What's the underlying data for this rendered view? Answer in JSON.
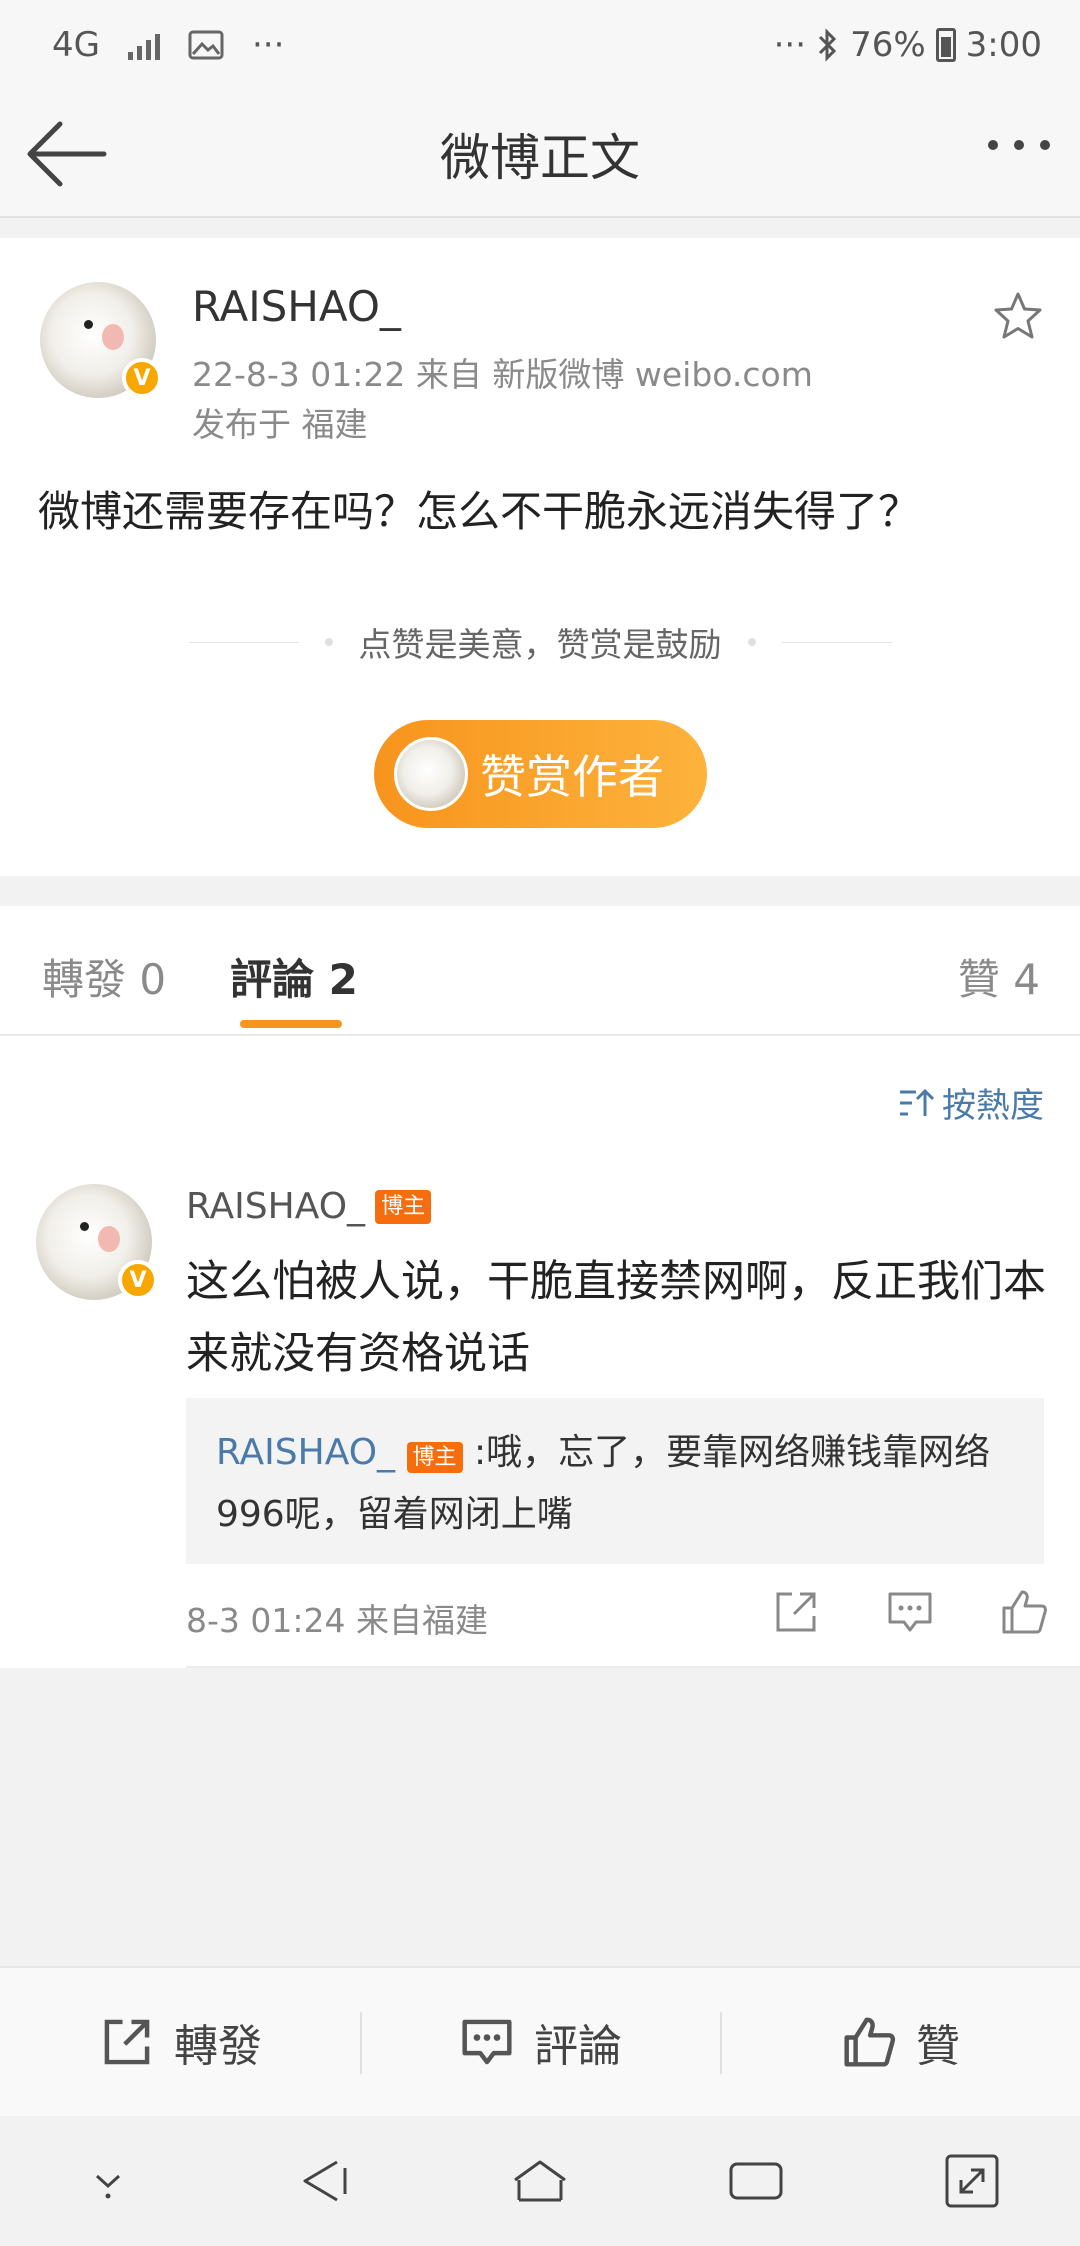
{
  "status_bar": {
    "network": "4G",
    "more": "···",
    "more_right": "···",
    "battery_percent": "76%",
    "time": "3:00"
  },
  "navbar": {
    "title": "微博正文"
  },
  "post": {
    "author": "RAISHAO_",
    "verified_badge": "V",
    "meta": "22-8-3 01:22   来自 新版微博 weibo.com",
    "location": "发布于 福建",
    "text": "微博还需要存在吗？怎么不干脆永远消失得了？",
    "reward_hint": "点赞是美意，赞赏是鼓励",
    "reward_button": "赞赏作者"
  },
  "tabs": {
    "repost": "轉發 0",
    "comment": "評論 2",
    "like": "贊 4"
  },
  "comments": {
    "sort_label": "按熱度",
    "items": [
      {
        "author": "RAISHAO_",
        "badge": "博主",
        "verified_badge": "V",
        "text": "这么怕被人说，干脆直接禁网啊，反正我们本来就没有资格说话",
        "reply": {
          "author": "RAISHAO_",
          "badge": "博主",
          "text": ":哦，忘了，要靠网络赚钱靠网络996呢，留着网闭上嘴"
        },
        "footer": "8-3 01:24  来自福建"
      }
    ]
  },
  "toolbar": {
    "repost": "轉發",
    "comment": "評論",
    "like": "贊"
  },
  "colors": {
    "accent_orange": "#f7941d",
    "link_blue": "#4a7aaa",
    "badge_orange": "#f56d0c",
    "verified_yellow": "#f7a700"
  }
}
